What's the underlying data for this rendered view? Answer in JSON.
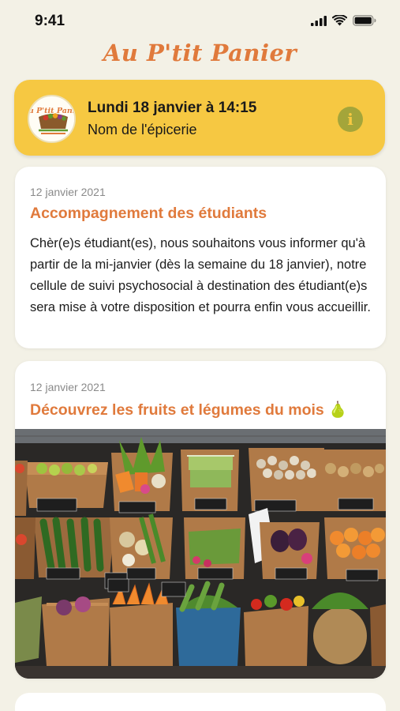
{
  "status_bar": {
    "time": "9:41",
    "icons": [
      "cellular-signal-icon",
      "wifi-icon",
      "battery-icon"
    ]
  },
  "header": {
    "app_title": "Au P'tit Panier"
  },
  "shop_banner": {
    "logo_text": "Au P'tit Panier",
    "date": "Lundi 18 janvier à 14:15",
    "store_name": "Nom de l'épicerie",
    "info_icon": "info-icon",
    "colors": {
      "background": "#f6c842",
      "info_button": "#a4a53a"
    }
  },
  "posts": [
    {
      "date": "12 janvier 2021",
      "title": "Accompagnement des étudiants",
      "body": "Chèr(e)s étudiant(es), nous souhaitons vous informer qu'à partir de la mi-janvier (dès la semaine du 18 janvier), notre cellule de suivi psychosocial à destination des étudiant(e)s sera mise à votre disposition et pourra enfin vous accueillir."
    },
    {
      "date": "12 janvier 2021",
      "title": "Découvrez les fruits et légumes du mois 🍐",
      "image": "fruits-vegetables-market-photo"
    }
  ],
  "colors": {
    "page_background": "#f3f1e6",
    "accent": "#e07a3c",
    "card_background": "#ffffff"
  }
}
